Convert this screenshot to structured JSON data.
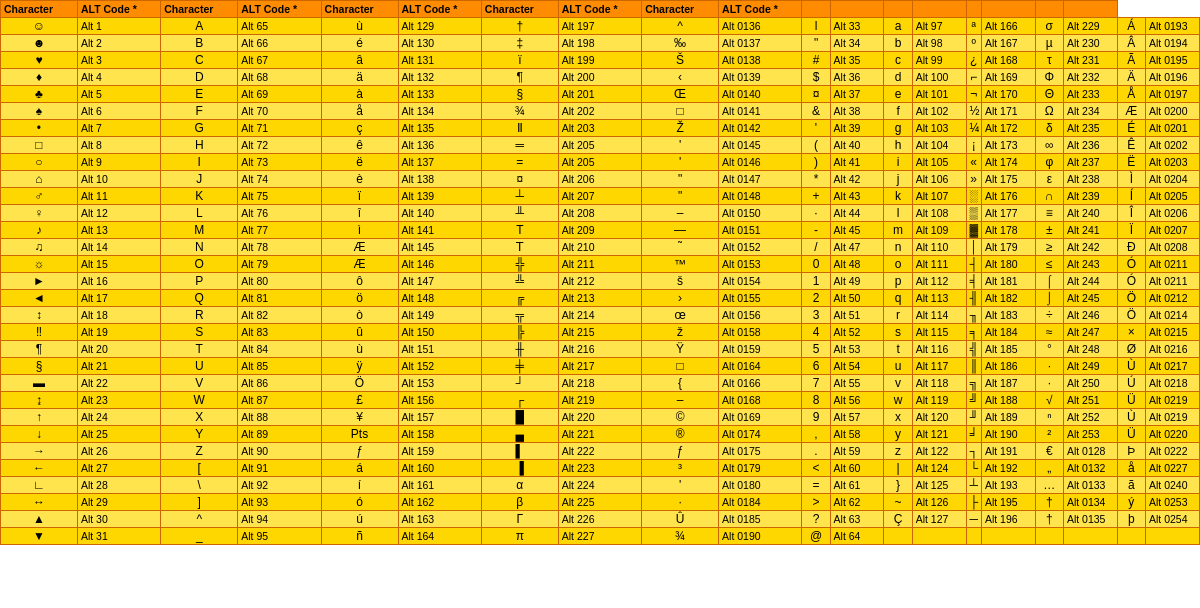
{
  "headers": [
    "Character",
    "ALT Code *",
    "Character",
    "ALT Code *",
    "Character",
    "ALT Code *",
    "Character",
    "ALT Code *",
    "Character",
    "ALT Code *",
    "",
    "",
    "",
    "",
    "",
    "",
    "",
    ""
  ],
  "rows": [
    [
      "☺",
      "Alt 1",
      "A",
      "Alt 65",
      "ù",
      "Alt 129",
      "†",
      "Alt 197",
      "^",
      "Alt 0136",
      "l",
      "Alt 33",
      "a",
      "Alt 97",
      "ª",
      "Alt 166",
      "σ",
      "Alt 229",
      "Á",
      "Alt 0193"
    ],
    [
      "☻",
      "Alt 2",
      "B",
      "Alt 66",
      "é",
      "Alt 130",
      "‡",
      "Alt 198",
      "‰",
      "Alt 0137",
      "\"",
      "Alt 34",
      "b",
      "Alt 98",
      "º",
      "Alt 167",
      "µ",
      "Alt 230",
      "Â",
      "Alt 0194"
    ],
    [
      "♥",
      "Alt 3",
      "C",
      "Alt 67",
      "â",
      "Alt 131",
      "ï",
      "Alt 199",
      "Š",
      "Alt 0138",
      "#",
      "Alt 35",
      "c",
      "Alt 99",
      "¿",
      "Alt 168",
      "τ",
      "Alt 231",
      "Ã",
      "Alt 0195"
    ],
    [
      "♦",
      "Alt 4",
      "D",
      "Alt 68",
      "ä",
      "Alt 132",
      "¶",
      "Alt 200",
      "‹",
      "Alt 0139",
      "$",
      "Alt 36",
      "d",
      "Alt 100",
      "⌐",
      "Alt 169",
      "Φ",
      "Alt 232",
      "Ä",
      "Alt 0196"
    ],
    [
      "♣",
      "Alt 5",
      "E",
      "Alt 69",
      "à",
      "Alt 133",
      "§",
      "Alt 201",
      "Œ",
      "Alt 0140",
      "¤",
      "Alt 37",
      "e",
      "Alt 101",
      "¬",
      "Alt 170",
      "Θ",
      "Alt 233",
      "Å",
      "Alt 0197"
    ],
    [
      "♠",
      "Alt 6",
      "F",
      "Alt 70",
      "å",
      "Alt 134",
      "¾",
      "Alt 202",
      "□",
      "Alt 0141",
      "&",
      "Alt 38",
      "f",
      "Alt 102",
      "½",
      "Alt 171",
      "Ω",
      "Alt 234",
      "Æ",
      "Alt 0200"
    ],
    [
      "•",
      "Alt 7",
      "G",
      "Alt 71",
      "ç",
      "Alt 135",
      "Ⅱ",
      "Alt 203",
      "Ž",
      "Alt 0142",
      "'",
      "Alt 39",
      "g",
      "Alt 103",
      "¼",
      "Alt 172",
      "δ",
      "Alt 235",
      "É",
      "Alt 0201"
    ],
    [
      "□",
      "Alt 8",
      "H",
      "Alt 72",
      "ê",
      "Alt 136",
      "═",
      "Alt 205",
      "'",
      "Alt 0145",
      "(",
      "Alt 40",
      "h",
      "Alt 104",
      "¡",
      "Alt 173",
      "∞",
      "Alt 236",
      "Ê",
      "Alt 0202"
    ],
    [
      "○",
      "Alt 9",
      "I",
      "Alt 73",
      "ë",
      "Alt 137",
      "=",
      "Alt 205",
      "'",
      "Alt 0146",
      ")",
      "Alt 41",
      "i",
      "Alt 105",
      "«",
      "Alt 174",
      "φ",
      "Alt 237",
      "Ë",
      "Alt 0203"
    ],
    [
      "⌂",
      "Alt 10",
      "J",
      "Alt 74",
      "è",
      "Alt 138",
      "¤",
      "Alt 206",
      "\"",
      "Alt 0147",
      "*",
      "Alt 42",
      "j",
      "Alt 106",
      "»",
      "Alt 175",
      "ε",
      "Alt 238",
      "Ì",
      "Alt 0204"
    ],
    [
      "♂",
      "Alt 11",
      "K",
      "Alt 75",
      "ï",
      "Alt 139",
      "┴",
      "Alt 207",
      "\"",
      "Alt 0148",
      "+",
      "Alt 43",
      "k",
      "Alt 107",
      "░",
      "Alt 176",
      "∩",
      "Alt 239",
      "Í",
      "Alt 0205"
    ],
    [
      "♀",
      "Alt 12",
      "L",
      "Alt 76",
      "î",
      "Alt 140",
      "╨",
      "Alt 208",
      "–",
      "Alt 0150",
      "·",
      "Alt 44",
      "l",
      "Alt 108",
      "▒",
      "Alt 177",
      "≡",
      "Alt 240",
      "Î",
      "Alt 0206"
    ],
    [
      "♪",
      "Alt 13",
      "M",
      "Alt 77",
      "ì",
      "Alt 141",
      "Τ",
      "Alt 209",
      "—",
      "Alt 0151",
      "-",
      "Alt 45",
      "m",
      "Alt 109",
      "▓",
      "Alt 178",
      "±",
      "Alt 241",
      "Ï",
      "Alt 0207"
    ],
    [
      "♫",
      "Alt 14",
      "N",
      "Alt 78",
      "Æ",
      "Alt 145",
      "Τ̈",
      "Alt 210",
      "˜",
      "Alt 0152",
      "/",
      "Alt 47",
      "n",
      "Alt 110",
      "│",
      "Alt 179",
      "≥",
      "Alt 242",
      "Ð",
      "Alt 0208"
    ],
    [
      "☼",
      "Alt 15",
      "O",
      "Alt 79",
      "Æ",
      "Alt 146",
      "╬",
      "Alt 211",
      "™",
      "Alt 0153",
      "0",
      "Alt 48",
      "o",
      "Alt 111",
      "┤",
      "Alt 180",
      "≤",
      "Alt 243",
      "Ó",
      "Alt 0211"
    ],
    [
      "►",
      "Alt 16",
      "P",
      "Alt 80",
      "ô",
      "Alt 147",
      "╩",
      "Alt 212",
      "š",
      "Alt 0154",
      "1",
      "Alt 49",
      "p",
      "Alt 112",
      "╡",
      "Alt 181",
      "⌠",
      "Alt 244",
      "Ó",
      "Alt 0211"
    ],
    [
      "◄",
      "Alt 17",
      "Q",
      "Alt 81",
      "ö",
      "Alt 148",
      "╔",
      "Alt 213",
      "›",
      "Alt 0155",
      "2",
      "Alt 50",
      "q",
      "Alt 113",
      "╢",
      "Alt 182",
      "⌡",
      "Alt 245",
      "Ö",
      "Alt 0212"
    ],
    [
      "↕",
      "Alt 18",
      "R",
      "Alt 82",
      "ò",
      "Alt 149",
      "╦",
      "Alt 214",
      "œ",
      "Alt 0156",
      "3",
      "Alt 51",
      "r",
      "Alt 114",
      "╖",
      "Alt 183",
      "÷",
      "Alt 246",
      "Ö",
      "Alt 0214"
    ],
    [
      "‼",
      "Alt 19",
      "S",
      "Alt 83",
      "û",
      "Alt 150",
      "╠",
      "Alt 215",
      "ž",
      "Alt 0158",
      "4",
      "Alt 52",
      "s",
      "Alt 115",
      "╕",
      "Alt 184",
      "≈",
      "Alt 247",
      "×",
      "Alt 0215"
    ],
    [
      "¶",
      "Alt 20",
      "T",
      "Alt 84",
      "ù",
      "Alt 151",
      "╫",
      "Alt 216",
      "Ÿ",
      "Alt 0159",
      "5",
      "Alt 53",
      "t",
      "Alt 116",
      "╣",
      "Alt 185",
      "°",
      "Alt 248",
      "Ø",
      "Alt 0216"
    ],
    [
      "§",
      "Alt 21",
      "U",
      "Alt 85",
      "ÿ",
      "Alt 152",
      "╪",
      "Alt 217",
      "□",
      "Alt 0164",
      "6",
      "Alt 54",
      "u",
      "Alt 117",
      "║",
      "Alt 186",
      "·",
      "Alt 249",
      "Ù",
      "Alt 0217"
    ],
    [
      "▬",
      "Alt 22",
      "V",
      "Alt 86",
      "Ö",
      "Alt 153",
      "┘",
      "Alt 218",
      "{",
      "Alt 0166",
      "7",
      "Alt 55",
      "v",
      "Alt 118",
      "╗",
      "Alt 187",
      "·",
      "Alt 250",
      "Ú",
      "Alt 0218"
    ],
    [
      "↨",
      "Alt 23",
      "W",
      "Alt 87",
      "£",
      "Alt 156",
      "┌",
      "Alt 219",
      "–",
      "Alt 0168",
      "8",
      "Alt 56",
      "w",
      "Alt 119",
      "╝",
      "Alt 188",
      "√",
      "Alt 251",
      "Ü",
      "Alt 0219"
    ],
    [
      "↑",
      "Alt 24",
      "X",
      "Alt 88",
      "¥",
      "Alt 157",
      "█",
      "Alt 220",
      "©",
      "Alt 0169",
      "9",
      "Alt 57",
      "x",
      "Alt 120",
      "╜",
      "Alt 189",
      "ⁿ",
      "Alt 252",
      "Ù",
      "Alt 0219"
    ],
    [
      "↓",
      "Alt 25",
      "Y",
      "Alt 89",
      "Pts",
      "Alt 158",
      "▄",
      "Alt 221",
      "®",
      "Alt 0174",
      ",",
      "Alt 58",
      "y",
      "Alt 121",
      "╛",
      "Alt 190",
      "²",
      "Alt 253",
      "Ü",
      "Alt 0220"
    ],
    [
      "→",
      "Alt 26",
      "Z",
      "Alt 90",
      "ƒ",
      "Alt 159",
      "▌",
      "Alt 222",
      "ƒ",
      "Alt 0175",
      ".",
      "Alt 59",
      "z",
      "Alt 122",
      "┐",
      "Alt 191",
      "€",
      "Alt 0128",
      "Þ",
      "Alt 0222"
    ],
    [
      "←",
      "Alt 27",
      "[",
      "Alt 91",
      "á",
      "Alt 160",
      "▐",
      "Alt 223",
      "³",
      "Alt 0179",
      "<",
      "Alt 60",
      "|",
      "Alt 124",
      "└",
      "Alt 192",
      "„",
      "Alt 0132",
      "å",
      "Alt 0227"
    ],
    [
      "∟",
      "Alt 28",
      "\\",
      "Alt 92",
      "í",
      "Alt 161",
      "α",
      "Alt 224",
      "'",
      "Alt 0180",
      "=",
      "Alt 61",
      "}",
      "Alt 125",
      "┴",
      "Alt 193",
      "…",
      "Alt 0133",
      "ã",
      "Alt 0240"
    ],
    [
      "↔",
      "Alt 29",
      "]",
      "Alt 93",
      "ó",
      "Alt 162",
      "β",
      "Alt 225",
      "·",
      "Alt 0184",
      ">",
      "Alt 62",
      "~",
      "Alt 126",
      "├",
      "Alt 195",
      "†",
      "Alt 0134",
      "ý",
      "Alt 0253"
    ],
    [
      "▲",
      "Alt 30",
      "^",
      "Alt 94",
      "ú",
      "Alt 163",
      "Γ",
      "Alt 226",
      "Û",
      "Alt 0185",
      "?",
      "Alt 63",
      "Ç",
      "Alt 127",
      "─",
      "Alt 196",
      "†",
      "Alt 0135",
      "þ",
      "Alt 0254"
    ],
    [
      "▼",
      "Alt 31",
      "_",
      "Alt 95",
      "ñ",
      "Alt 164",
      "π",
      "Alt 227",
      "¾",
      "Alt 0190",
      "@",
      "Alt 64",
      "",
      "",
      "",
      "",
      "",
      "",
      "",
      ""
    ]
  ]
}
